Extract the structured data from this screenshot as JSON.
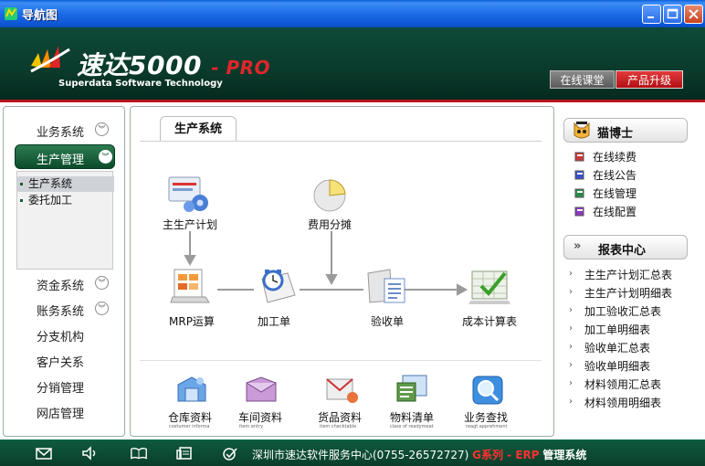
{
  "window": {
    "title": "导航图"
  },
  "banner": {
    "brand_name": "速达5000",
    "brand_suffix": "- PRO",
    "tagline": "Superdata Software Technology",
    "online_class": "在线课堂",
    "upgrade": "产品升级"
  },
  "leftnav": {
    "items": [
      {
        "label": "业务系统"
      },
      {
        "label": "生产管理"
      },
      {
        "label": "资金系统"
      },
      {
        "label": "账务系统"
      },
      {
        "label": "分支机构"
      },
      {
        "label": "客户关系"
      },
      {
        "label": "分销管理"
      },
      {
        "label": "网店管理"
      }
    ],
    "sub_items": [
      {
        "label": "生产系统"
      },
      {
        "label": "委托加工"
      }
    ]
  },
  "main": {
    "tab": "生产系统",
    "flow": {
      "plan": "主生产计划",
      "cost_alloc": "费用分摊",
      "mrp": "MRP运算",
      "process": "加工单",
      "receipt": "验收单",
      "cost_calc": "成本计算表"
    },
    "tools": [
      {
        "label": "仓库资料",
        "sub": "costumer informa"
      },
      {
        "label": "车间资料",
        "sub": "item entry"
      },
      {
        "label": "货品资料",
        "sub": "item checktable"
      },
      {
        "label": "物料清单",
        "sub": "class of readymeat"
      },
      {
        "label": "业务查找",
        "sub": "reagt apprehment"
      }
    ]
  },
  "right": {
    "doctor": {
      "title": "猫博士",
      "links": [
        {
          "label": "在线续费"
        },
        {
          "label": "在线公告"
        },
        {
          "label": "在线管理"
        },
        {
          "label": "在线配置"
        }
      ]
    },
    "reports": {
      "title": "报表中心",
      "prefix": "»",
      "links": [
        {
          "label": "主生产计划汇总表"
        },
        {
          "label": "主生产计划明细表"
        },
        {
          "label": "加工验收汇总表"
        },
        {
          "label": "加工单明细表"
        },
        {
          "label": "验收单汇总表"
        },
        {
          "label": "验收单明细表"
        },
        {
          "label": "材料领用汇总表"
        },
        {
          "label": "材料领用明细表"
        }
      ]
    }
  },
  "footer": {
    "service": "深圳市速达软件服务中心(0755-26572727)",
    "series": "G系列 - ERP",
    "system": "管理系统"
  },
  "colors": {
    "brand_green": "#0e4a38",
    "accent_red": "#b8151b"
  }
}
